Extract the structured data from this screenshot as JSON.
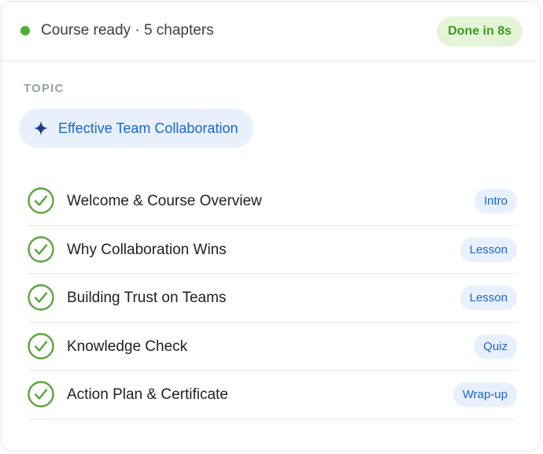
{
  "header": {
    "status_text": "Course ready · 5 chapters",
    "done_badge": "Done in 8s"
  },
  "topic": {
    "label": "TOPIC",
    "title": "Effective Team Collaboration",
    "icon": "sparkle-icon"
  },
  "chapters": [
    {
      "title": "Welcome & Course Overview",
      "tag": "Intro",
      "status": "complete"
    },
    {
      "title": "Why Collaboration Wins",
      "tag": "Lesson",
      "status": "complete"
    },
    {
      "title": "Building Trust on Teams",
      "tag": "Lesson",
      "status": "complete"
    },
    {
      "title": "Knowledge Check",
      "tag": "Quiz",
      "status": "complete"
    },
    {
      "title": "Action Plan & Certificate",
      "tag": "Wrap-up",
      "status": "complete"
    }
  ],
  "colors": {
    "status_dot": "#4caf32",
    "done_badge_bg": "#e3f5d6",
    "done_badge_text": "#3f9a22",
    "topic_chip_bg": "#e8f0fd",
    "topic_text": "#1967d2",
    "sparkle": "#1a3e8c",
    "check": "#5aa33c",
    "tag_bg": "#e8f0fd",
    "tag_text": "#1967d2"
  }
}
